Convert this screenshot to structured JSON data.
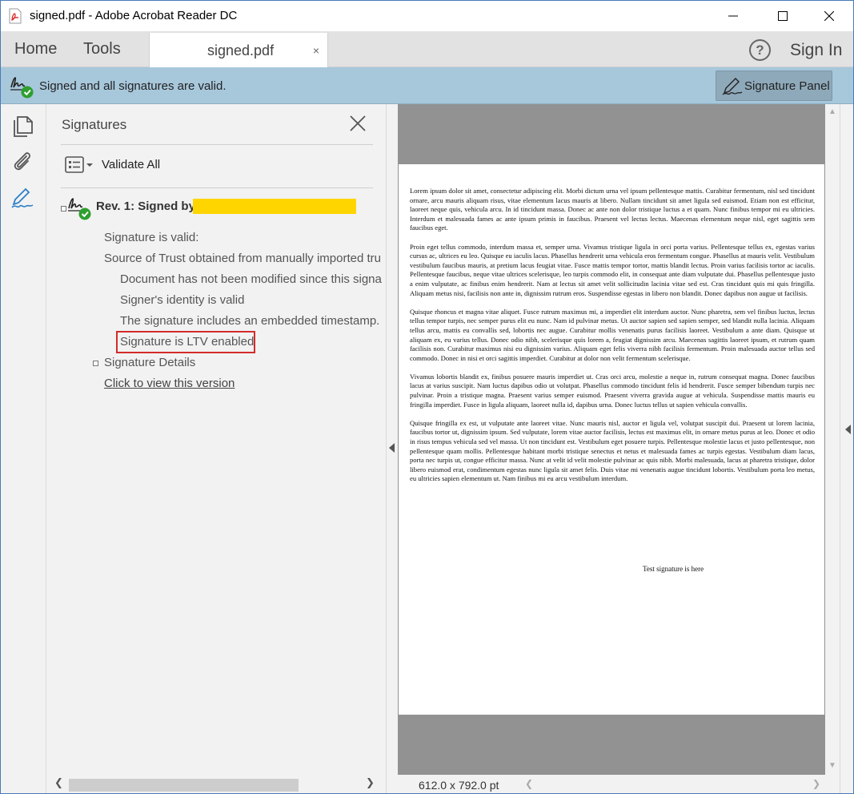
{
  "window": {
    "title": "signed.pdf - Adobe Acrobat Reader DC"
  },
  "menubar": {
    "home": "Home",
    "tools": "Tools",
    "doc_tab": "signed.pdf",
    "doc_tab_close": "×",
    "help": "?",
    "sign_in": "Sign In"
  },
  "sigbar": {
    "message": "Signed and all signatures are valid.",
    "panel_button": "Signature Panel"
  },
  "panel": {
    "title": "Signatures",
    "validate_all": "Validate All",
    "revision_label": "Rev. 1: Signed by",
    "details": [
      "Signature is valid:",
      "Source of Trust obtained from manually imported tru",
      "Document has not been modified since this signa",
      "Signer's identity is valid",
      "The signature includes an embedded timestamp.",
      "Signature is LTV enabled"
    ],
    "signature_details": "Signature Details",
    "view_version": "Click to view this version"
  },
  "document": {
    "paragraphs": [
      "Lorem ipsum dolor sit amet, consectetur adipiscing elit. Morbi dictum urna vel ipsum pellentesque mattis. Curabitur fermentum, nisl sed tincidunt ornare, arcu mauris aliquam risus, vitae elementum lacus mauris at libero. Nullam tincidunt sit amet ligula sed euismod. Etiam non est efficitur, laoreet neque quis, vehicula arcu. In id tincidunt massa. Donec ac ante non dolor tristique luctus a et quam. Nunc finibus tempor mi eu ultricies. Interdum et malesuada fames ac ante ipsum primis in faucibus. Praesent vel lectus lectus. Maecenas elementum neque nisl, eget sagittis sem faucibus eget.",
      "Proin eget tellus commodo, interdum massa et, semper urna. Vivamus tristique ligula in orci porta varius. Pellentesque tellus ex, egestas varius cursus ac, ultrices eu leo. Quisque eu iaculis lacus. Phasellus hendrerit urna vehicula eros fermentum congue. Phasellus at mauris velit. Vestibulum vestibulum faucibus mauris, at pretium lacus feugiat vitae. Fusce mattis tempor tortor, mattis blandit lectus. Proin varius facilisis tortor ac iaculis. Pellentesque faucibus, neque vitae ultrices scelerisque, leo turpis commodo elit, in consequat ante diam vulputate dui. Phasellus pellentesque justo a enim vulputate, ac finibus enim hendrerit. Nam at lectus sit amet velit sollicitudin lacinia vitae sed est. Cras tincidunt quis mi quis fringilla. Aliquam metus nisi, facilisis non ante in, dignissim rutrum eros. Suspendisse egestas in libero non blandit. Donec dapibus non augue ut facilisis.",
      "Quisque rhoncus et magna vitae aliquet. Fusce rutrum maximus mi, a imperdiet elit interdum auctor. Nunc pharetra, sem vel finibus luctus, lectus tellus tempor turpis, nec semper purus elit eu nunc. Nam id pulvinar metus. Ut auctor sapien sed sapien semper, sed blandit nulla lacinia. Aliquam tellus arcu, mattis eu convallis sed, lobortis nec augue. Curabitur mollis venenatis purus facilisis laoreet. Vestibulum a ante diam. Quisque ut aliquam ex, eu varius tellus. Donec odio nibh, scelerisque quis lorem a, feugiat dignissim arcu. Maecenas sagittis laoreet ipsum, et rutrum quam facilisis non. Curabitur maximus nisi eu dignissim varius. Aliquam eget felis viverra nibh facilisis fermentum. Proin malesuada auctor tellus sed commodo. Donec in nisi et orci sagittis imperdiet. Curabitur at dolor non velit fermentum scelerisque.",
      "Vivamus lobortis blandit ex, finibus posuere mauris imperdiet ut. Cras orci arcu, molestie a neque in, rutrum consequat magna. Donec faucibus lacus at varius suscipit. Nam luctus dapibus odio ut volutpat. Phasellus commodo tincidunt felis id hendrerit. Fusce semper bibendum turpis nec pulvinar. Proin a tristique magna. Praesent varius semper euismod. Praesent viverra gravida augue at vehicula. Suspendisse mattis mauris eu fringilla imperdiet. Fusce in ligula aliquam, laoreet nulla id, dapibus urna. Donec luctus tellus ut sapien vehicula convallis.",
      "Quisque fringilla ex est, ut vulputate ante laoreet vitae. Nunc mauris nisl, auctor et ligula vel, volutpat suscipit dui. Praesent ut lorem lacinia, faucibus tortor ut, dignissim ipsum. Sed vulputate, lorem vitae auctor facilisis, lectus est maximus elit, in ornare metus purus at leo. Donec et odio in risus tempus vehicula sed vel massa. Ut non tincidunt est. Vestibulum eget posuere turpis. Pellentesque molestie lacus et justo pellentesque, non pellentesque quam mollis. Pellentesque habitant morbi tristique senectus et netus et malesuada fames ac turpis egestas. Vestibulum diam lacus, porta nec turpis ut, congue efficitur massa. Nunc at velit id velit molestie pulvinar ac quis nibh. Morbi malesuada, lacus at pharetra tristique, dolor libero euismod erat, condimentum egestas nunc ligula sit amet felis. Duis vitae mi venenatis augue tincidunt lobortis. Vestibulum porta leo metus, eu ultricies sapien elementum ut. Nam finibus mi eu arcu vestibulum interdum."
    ],
    "signature_line": "Test signature is here",
    "page_size": "612.0 x 792.0 pt"
  },
  "colors": {
    "sigbar_bg": "#a7c7db",
    "valid_green": "#2e9f2e",
    "highlight_red": "#d32b2b",
    "redaction_yellow": "#ffd500",
    "sign_blue": "#2e7fc8"
  },
  "icons": {
    "app": "pdf-icon",
    "help": "help-icon",
    "valid_signature": "valid-signature-icon",
    "pages": "pages-icon",
    "attachments": "paperclip-icon",
    "signatures": "signature-pen-icon",
    "close": "close-icon",
    "options": "options-menu-icon"
  }
}
